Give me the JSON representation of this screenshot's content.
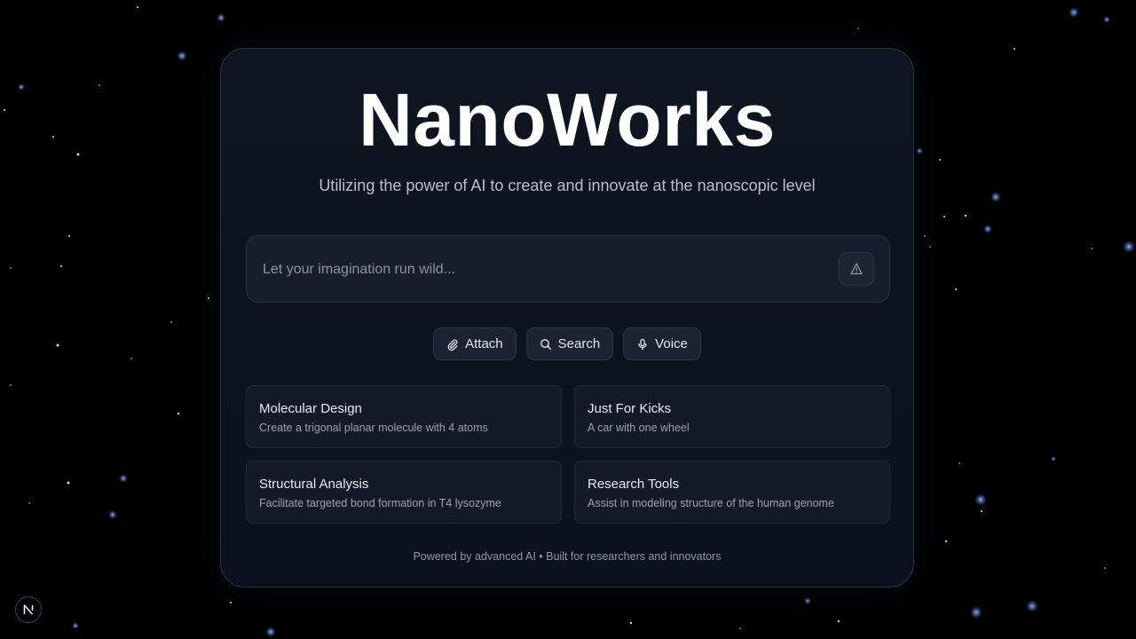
{
  "header": {
    "title": "NanoWorks",
    "subtitle": "Utilizing the power of AI to create and innovate at the nanoscopic level"
  },
  "prompt": {
    "placeholder": "Let your imagination run wild...",
    "value": "",
    "send_icon": "send-triangle-icon"
  },
  "actions": [
    {
      "label": "Attach",
      "icon": "paperclip-icon"
    },
    {
      "label": "Search",
      "icon": "search-icon"
    },
    {
      "label": "Voice",
      "icon": "microphone-icon"
    }
  ],
  "suggestions": [
    {
      "title": "Molecular Design",
      "description": "Create a trigonal planar molecule with 4 atoms"
    },
    {
      "title": "Just For Kicks",
      "description": "A car with one wheel"
    },
    {
      "title": "Structural Analysis",
      "description": "Facilitate targeted bond formation in T4 lysozyme"
    },
    {
      "title": "Research Tools",
      "description": "Assist in modeling structure of the human genome"
    }
  ],
  "footer": {
    "text": "Powered by advanced AI • Built for researchers and innovators"
  },
  "badge": {
    "letter": "N"
  },
  "colors": {
    "background": "#000000",
    "card": "#0e1420",
    "accent_star": "#5b7fd0",
    "text_primary": "#ffffff"
  }
}
